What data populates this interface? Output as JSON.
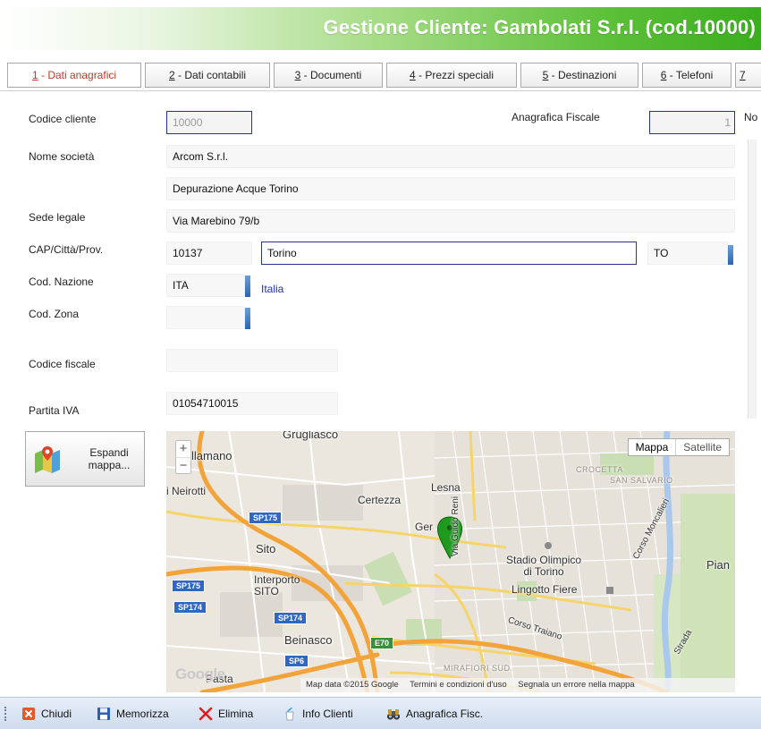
{
  "header": {
    "title": "Gestione Cliente: Gambolati S.r.l. (cod.10000)"
  },
  "tabs": [
    {
      "num": "1",
      "label": " - Dati anagrafici"
    },
    {
      "num": "2",
      "label": " - Dati contabili"
    },
    {
      "num": "3",
      "label": " - Documenti"
    },
    {
      "num": "4",
      "label": " - Prezzi speciali"
    },
    {
      "num": "5",
      "label": " - Destinazioni"
    },
    {
      "num": "6",
      "label": " - Telefoni"
    },
    {
      "num": "7",
      "label": ""
    }
  ],
  "form": {
    "codice_cliente_label": "Codice cliente",
    "codice_cliente": "10000",
    "anagrafica_fiscale_label": "Anagrafica Fiscale",
    "anagrafica_fiscale": "1",
    "edge_label": "No",
    "nome_societa_label": "Nome società",
    "nome_societa": "Arcom S.r.l.",
    "nome_societa_2": "Depurazione Acque Torino",
    "sede_legale_label": "Sede legale",
    "sede_legale": "Via Marebino 79/b",
    "cap_label": "CAP/Città/Prov.",
    "cap": "10137",
    "citta": "Torino",
    "prov": "TO",
    "nazione_label": "Cod. Nazione",
    "nazione": "ITA",
    "nazione_desc": "Italia",
    "zona_label": "Cod. Zona",
    "zona": "",
    "codice_fiscale_label": "Codice fiscale",
    "codice_fiscale": "",
    "partita_iva_label": "Partita IVA",
    "partita_iva": "01054710015"
  },
  "expand_map": {
    "label": "Espandi\nmappa..."
  },
  "map": {
    "zoom_in": "+",
    "zoom_out": "−",
    "type_map": "Mappa",
    "type_satellite": "Satellite",
    "places": {
      "grugliasco": "Grugliasco",
      "villamano": "llamano",
      "neirotti": "i Neirotti",
      "certezza": "Certezza",
      "lesna": "Lesna",
      "gerbido": "Ger",
      "via_guido_reni": "Via Guido Reni",
      "crocetta": "CROCETTA",
      "san_salvario": "SAN SALVARIO",
      "sito": "Sito",
      "interporto": "Interporto\nSITO",
      "stadio": "Stadio Olimpico\ndi Torino",
      "lingotto": "Lingotto Fiere",
      "corso_moncalieri": "Corso Moncalieri",
      "pian": "Pian",
      "corso_traiano": "Corso Traiano",
      "beinasco": "Beinasco",
      "mirafiori": "MIRAFIORI SUD",
      "pasta": "Pasta",
      "strada": "Strada"
    },
    "shields": {
      "sp175_a": "SP175",
      "sp175_b": "SP175",
      "sp174_a": "SP174",
      "sp174_b": "SP174",
      "sp6": "SP6",
      "e70": "E70"
    },
    "google": "Google",
    "footer": {
      "data": "Map data ©2015 Google",
      "terms": "Termini e condizioni d'uso",
      "report": "Segnala un errore nella mappa"
    }
  },
  "toolbar": {
    "chiudi": "Chiudi",
    "memorizza": "Memorizza",
    "elimina": "Elimina",
    "info": "Info Clienti",
    "anagrafica": "Anagrafica Fisc."
  },
  "colors": {
    "accent": "#3aae1f",
    "tab_active": "#c0392b",
    "link": "#1a2fbf",
    "focus_border": "#27348b",
    "marker": "#1f9a1f"
  }
}
